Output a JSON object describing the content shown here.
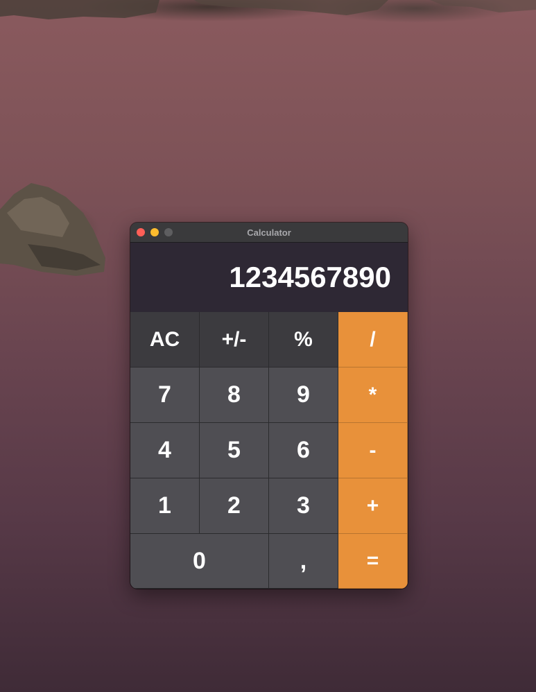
{
  "window": {
    "title": "Calculator"
  },
  "display": {
    "value": "1234567890"
  },
  "keys": {
    "clear": "AC",
    "sign": "+/-",
    "percent": "%",
    "divide": "/",
    "seven": "7",
    "eight": "8",
    "nine": "9",
    "multiply": "*",
    "four": "4",
    "five": "5",
    "six": "6",
    "subtract": "-",
    "one": "1",
    "two": "2",
    "three": "3",
    "add": "+",
    "zero": "0",
    "decimal": ",",
    "equals": "="
  },
  "colors": {
    "operator": "#e8913a",
    "function_key": "#3c3b3f",
    "number_key": "#4f4e53",
    "display_bg": "#2e2834",
    "close": "#ff5f57",
    "minimize": "#febc2e",
    "maximize": "#5e5e60"
  }
}
